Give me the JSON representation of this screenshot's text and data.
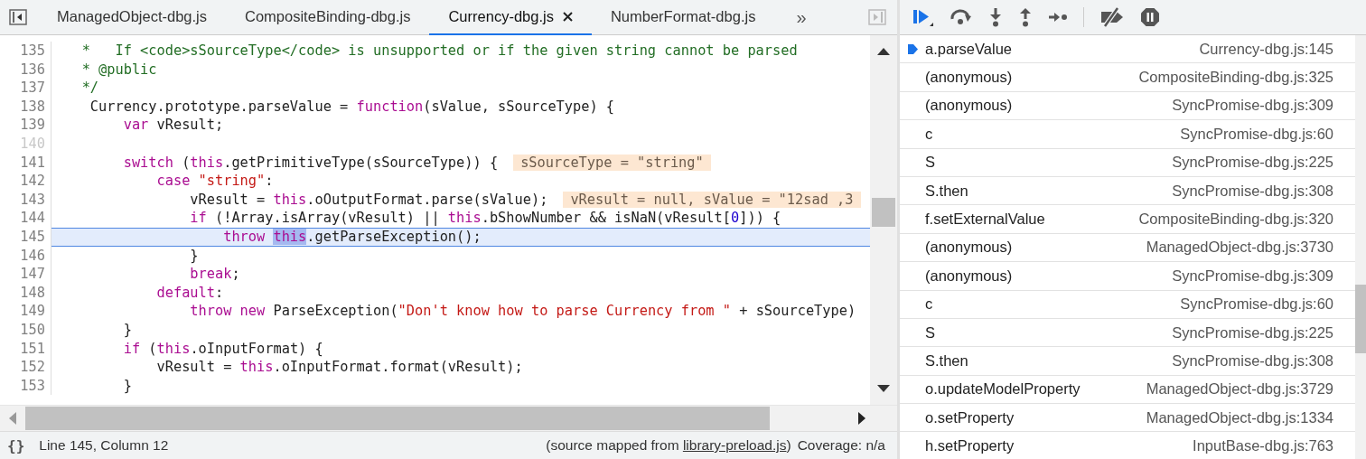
{
  "tabs": [
    {
      "label": "ManagedObject-dbg.js",
      "selected": false
    },
    {
      "label": "CompositeBinding-dbg.js",
      "selected": false
    },
    {
      "label": "Currency-dbg.js",
      "selected": true
    },
    {
      "label": "NumberFormat-dbg.js",
      "selected": false
    }
  ],
  "more_tabs": "»",
  "lines": [
    {
      "number": "135",
      "dim": false,
      "current": false,
      "tokens": [
        {
          "kind": "comment",
          "text": "   *   If <code>sSourceType</code> is unsupported or if the given string cannot be parsed"
        }
      ]
    },
    {
      "number": "136",
      "dim": false,
      "current": false,
      "tokens": [
        {
          "kind": "comment",
          "text": "   * @public"
        }
      ]
    },
    {
      "number": "137",
      "dim": false,
      "current": false,
      "tokens": [
        {
          "kind": "comment",
          "text": "   */"
        }
      ]
    },
    {
      "number": "138",
      "dim": false,
      "current": false,
      "tokens": [
        {
          "kind": "plain",
          "text": "    Currency.prototype.parseValue = "
        },
        {
          "kind": "keyword",
          "text": "function"
        },
        {
          "kind": "plain",
          "text": "(sValue, sSourceType) {"
        }
      ]
    },
    {
      "number": "139",
      "dim": false,
      "current": false,
      "tokens": [
        {
          "kind": "keyword",
          "text": "        var"
        },
        {
          "kind": "plain",
          "text": " vResult;"
        }
      ]
    },
    {
      "number": "140",
      "dim": true,
      "current": false
    },
    {
      "number": "141",
      "dim": false,
      "current": false,
      "tokens": [
        {
          "kind": "keyword",
          "text": "        switch"
        },
        {
          "kind": "plain",
          "text": " ("
        },
        {
          "kind": "keyword",
          "text": "this"
        },
        {
          "kind": "plain",
          "text": ".getPrimitiveType(sSourceType)) {"
        }
      ],
      "inline_value": "sSourceType = \"string\""
    },
    {
      "number": "142",
      "dim": false,
      "current": false,
      "tokens": [
        {
          "kind": "keyword",
          "text": "            case "
        },
        {
          "kind": "string",
          "text": "\"string\""
        },
        {
          "kind": "plain",
          "text": ":"
        }
      ]
    },
    {
      "number": "143",
      "dim": false,
      "current": false,
      "tokens": [
        {
          "kind": "plain",
          "text": "                vResult = "
        },
        {
          "kind": "keyword",
          "text": "this"
        },
        {
          "kind": "plain",
          "text": ".oOutputFormat.parse(sValue);"
        }
      ],
      "inline_value": "vResult = null, sValue = \"12sad ,3"
    },
    {
      "number": "144",
      "dim": false,
      "current": false,
      "tokens": [
        {
          "kind": "keyword",
          "text": "                if"
        },
        {
          "kind": "plain",
          "text": " (!Array.isArray(vResult) || "
        },
        {
          "kind": "keyword",
          "text": "this"
        },
        {
          "kind": "plain",
          "text": ".bShowNumber && isNaN(vResult["
        },
        {
          "kind": "number",
          "text": "0"
        },
        {
          "kind": "plain",
          "text": "])) {"
        }
      ]
    },
    {
      "number": "145",
      "dim": false,
      "current": true,
      "tokens": [
        {
          "kind": "keyword",
          "text": "                    throw "
        },
        {
          "kind": "match",
          "text": "this"
        },
        {
          "kind": "plain",
          "text": ".getParseException();"
        }
      ]
    },
    {
      "number": "146",
      "dim": false,
      "current": false,
      "tokens": [
        {
          "kind": "plain",
          "text": "                }"
        }
      ]
    },
    {
      "number": "147",
      "dim": false,
      "current": false,
      "tokens": [
        {
          "kind": "keyword",
          "text": "                break"
        },
        {
          "kind": "plain",
          "text": ";"
        }
      ]
    },
    {
      "number": "148",
      "dim": false,
      "current": false,
      "tokens": [
        {
          "kind": "keyword",
          "text": "            default"
        },
        {
          "kind": "plain",
          "text": ":"
        }
      ]
    },
    {
      "number": "149",
      "dim": false,
      "current": false,
      "tokens": [
        {
          "kind": "keyword",
          "text": "                throw new"
        },
        {
          "kind": "plain",
          "text": " ParseException("
        },
        {
          "kind": "string",
          "text": "\"Don't know how to parse Currency from \""
        },
        {
          "kind": "plain",
          "text": " + sSourceType)"
        }
      ]
    },
    {
      "number": "150",
      "dim": false,
      "current": false,
      "tokens": [
        {
          "kind": "plain",
          "text": "        }"
        }
      ]
    },
    {
      "number": "151",
      "dim": false,
      "current": false,
      "tokens": [
        {
          "kind": "keyword",
          "text": "        if"
        },
        {
          "kind": "plain",
          "text": " ("
        },
        {
          "kind": "keyword",
          "text": "this"
        },
        {
          "kind": "plain",
          "text": ".oInputFormat) {"
        }
      ]
    },
    {
      "number": "152",
      "dim": false,
      "current": false,
      "tokens": [
        {
          "kind": "plain",
          "text": "            vResult = "
        },
        {
          "kind": "keyword",
          "text": "this"
        },
        {
          "kind": "plain",
          "text": ".oInputFormat.format(vResult);"
        }
      ]
    },
    {
      "number": "153",
      "dim": false,
      "current": false,
      "tokens": [
        {
          "kind": "plain",
          "text": "        }"
        }
      ]
    }
  ],
  "status_bar": {
    "format_button": "{}",
    "position": "Line 145, Column 12",
    "source_prefix": "(source mapped from ",
    "source_link": "library-preload.js",
    "source_suffix": ")",
    "coverage": "Coverage: n/a"
  },
  "call_stack": [
    {
      "name": "a.parseValue",
      "location": "Currency-dbg.js:145",
      "current": true
    },
    {
      "name": "(anonymous)",
      "location": "CompositeBinding-dbg.js:325",
      "current": false
    },
    {
      "name": "(anonymous)",
      "location": "SyncPromise-dbg.js:309",
      "current": false
    },
    {
      "name": "c",
      "location": "SyncPromise-dbg.js:60",
      "current": false
    },
    {
      "name": "S",
      "location": "SyncPromise-dbg.js:225",
      "current": false
    },
    {
      "name": "S.then",
      "location": "SyncPromise-dbg.js:308",
      "current": false
    },
    {
      "name": "f.setExternalValue",
      "location": "CompositeBinding-dbg.js:320",
      "current": false
    },
    {
      "name": "(anonymous)",
      "location": "ManagedObject-dbg.js:3730",
      "current": false
    },
    {
      "name": "(anonymous)",
      "location": "SyncPromise-dbg.js:309",
      "current": false
    },
    {
      "name": "c",
      "location": "SyncPromise-dbg.js:60",
      "current": false
    },
    {
      "name": "S",
      "location": "SyncPromise-dbg.js:225",
      "current": false
    },
    {
      "name": "S.then",
      "location": "SyncPromise-dbg.js:308",
      "current": false
    },
    {
      "name": "o.updateModelProperty",
      "location": "ManagedObject-dbg.js:3729",
      "current": false
    },
    {
      "name": "o.setProperty",
      "location": "ManagedObject-dbg.js:1334",
      "current": false
    },
    {
      "name": "h.setProperty",
      "location": "InputBase-dbg.js:763",
      "current": false
    }
  ]
}
